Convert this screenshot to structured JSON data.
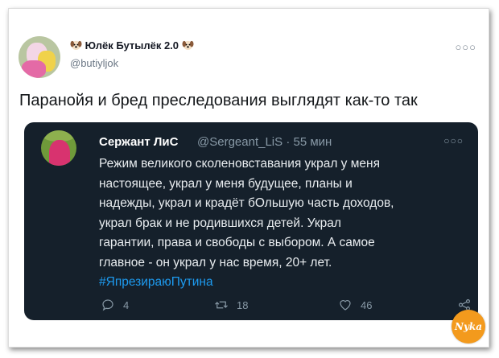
{
  "tweet": {
    "author_name": "Юлёк Бутылёк 2.0",
    "author_handle": "@butiyljok",
    "text": "Паранойя и бред преследования выглядят как-то так",
    "more_icon": "more-icon"
  },
  "quoted": {
    "author_name": "Сержант ЛиС",
    "author_handle": "@Sergeant_LiS",
    "separator": "·",
    "time": "55 мин",
    "lines": [
      "Режим великого сколеновставания украл у меня",
      "настоящее, украл у меня будущее, планы и",
      "надежды, украл и крадёт бОльшую часть доходов,",
      "украл брак и не родившихся детей. Украл",
      "гарантии, права и свободы с выбором. А самое",
      "главное - он украл у нас время, 20+ лет."
    ],
    "hashtag": "#ЯпрезираюПутина",
    "actions": {
      "replies": "4",
      "retweets": "18",
      "likes": "46"
    }
  },
  "watermark": "Nyka",
  "colors": {
    "card_bg": "#15202b",
    "hashtag": "#1d9bf0",
    "muted": "#8899a6"
  }
}
